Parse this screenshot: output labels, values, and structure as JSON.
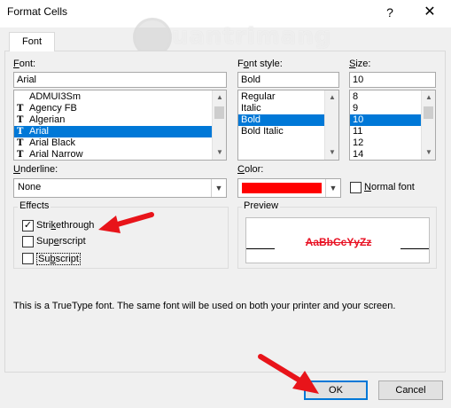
{
  "window": {
    "title": "Format Cells",
    "help_label": "?",
    "close_label": "✕"
  },
  "watermark": {
    "text": "uantrimang"
  },
  "tabs": [
    {
      "label": "Font",
      "active": true
    }
  ],
  "font": {
    "label": "Font:",
    "value": "Arial",
    "items": [
      "ADMUI3Sm",
      "Agency FB",
      "Algerian",
      "Arial",
      "Arial Black",
      "Arial Narrow"
    ],
    "item_icons": [
      "",
      "truetype-icon",
      "truetype-icon",
      "truetype-icon",
      "truetype-icon",
      "truetype-icon"
    ],
    "selected_index": 3
  },
  "font_style": {
    "label": "Font style:",
    "value": "Bold",
    "items": [
      "Regular",
      "Italic",
      "Bold",
      "Bold Italic"
    ],
    "selected_index": 2
  },
  "size": {
    "label": "Size:",
    "value": "10",
    "items": [
      "8",
      "9",
      "10",
      "11",
      "12",
      "14"
    ],
    "selected_index": 2
  },
  "underline": {
    "label": "Underline:",
    "value": "None"
  },
  "color": {
    "label": "Color:",
    "swatch": "#ff0000",
    "normal_font_label": "Normal font",
    "normal_font_checked": false
  },
  "effects": {
    "title": "Effects",
    "options": [
      {
        "label": "Strikethrough",
        "checked": true
      },
      {
        "label": "Superscript",
        "checked": false
      },
      {
        "label": "Subscript",
        "checked": false
      }
    ]
  },
  "preview": {
    "title": "Preview",
    "sample": "AaBbCcYyZz",
    "sample_color": "#e81123"
  },
  "info": "This is a TrueType font.  The same font will be used on both your printer and your screen.",
  "buttons": {
    "ok": "OK",
    "cancel": "Cancel"
  },
  "colors": {
    "selection": "#0078d7",
    "annotation_arrow": "#e8141a"
  }
}
